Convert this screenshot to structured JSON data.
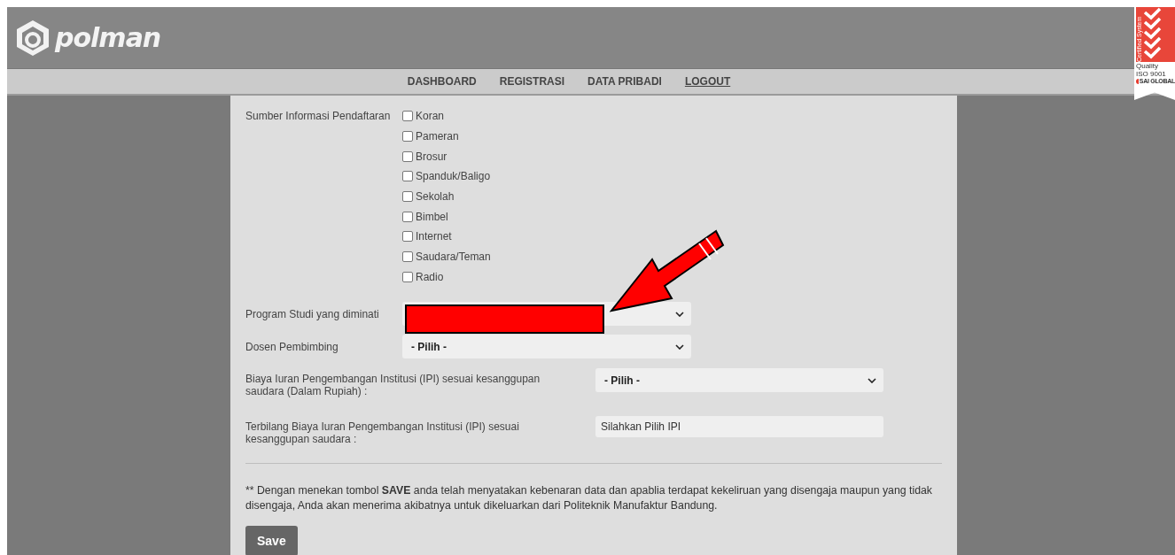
{
  "header": {
    "logo_text": "polman",
    "badge": {
      "vertical_text": "Certified System",
      "lines": [
        "Quality",
        "ISO 9001"
      ],
      "brand": "SAI GLOBAL"
    }
  },
  "nav": [
    {
      "label": "DASHBOARD",
      "selected": false
    },
    {
      "label": "REGISTRASI",
      "selected": false
    },
    {
      "label": "DATA PRIBADI",
      "selected": false
    },
    {
      "label": "LOGOUT",
      "selected": true
    }
  ],
  "form": {
    "source": {
      "label": "Sumber Informasi Pendaftaran",
      "options": [
        {
          "label": "Koran",
          "checked": false
        },
        {
          "label": "Pameran",
          "checked": false
        },
        {
          "label": "Brosur",
          "checked": false
        },
        {
          "label": "Spanduk/Baligo",
          "checked": false
        },
        {
          "label": "Sekolah",
          "checked": false
        },
        {
          "label": "Bimbel",
          "checked": false
        },
        {
          "label": "Internet",
          "checked": false
        },
        {
          "label": "Saudara/Teman",
          "checked": false
        },
        {
          "label": "Radio",
          "checked": false
        }
      ]
    },
    "program": {
      "label": "Program Studi yang diminati",
      "redacted": true
    },
    "dosen": {
      "label": "Dosen Pembimbing",
      "value": "- Pilih -"
    },
    "ipi": {
      "label": "Biaya Iuran Pengembangan Institusi (IPI) sesuai kesanggupan saudara (Dalam Rupiah) :",
      "value": "- Pilih -"
    },
    "terbilang": {
      "label": "Terbilang Biaya Iuran Pengembangan Institusi (IPI) sesuai kesanggupan saudara :",
      "value": "Silahkan Pilih IPI"
    },
    "note": "** Dengan menekan tombol **SAVE** anda telah menyatakan kebenaran data dan apablia terdapat kekeliruan yang disengaja maupun yang tidak disengaja, Anda akan menerima akibatnya untuk dikeluarkan dari Politeknik Manufaktur Bandung.",
    "save_button": "Save"
  }
}
